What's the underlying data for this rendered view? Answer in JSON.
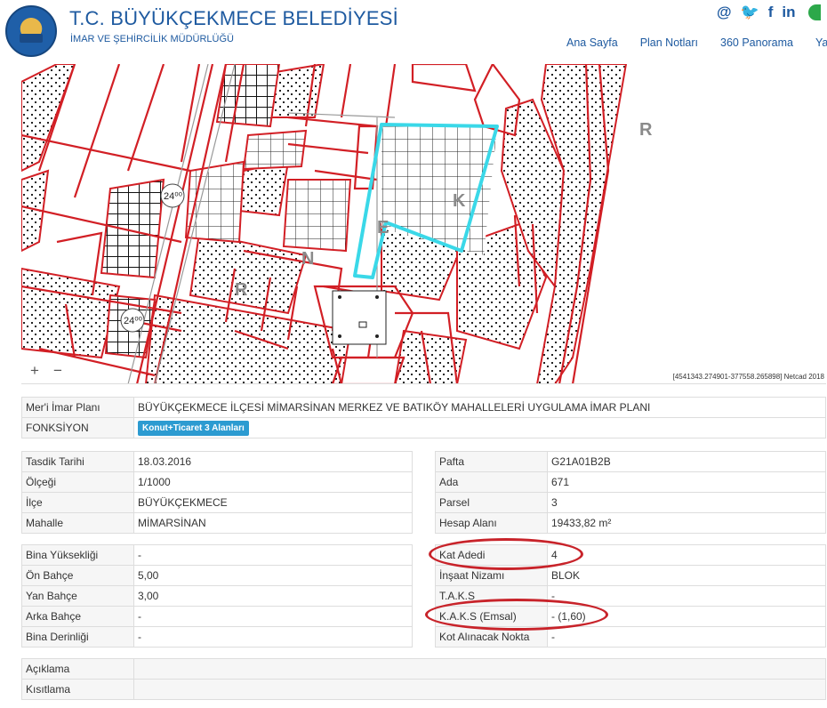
{
  "header": {
    "title": "T.C. BÜYÜKÇEKMECE BELEDİYESİ",
    "subtitle": "İMAR VE ŞEHİRCİLİK MÜDÜRLÜĞÜ",
    "social": [
      "@",
      "🐦",
      "f",
      "in"
    ],
    "nav": [
      "Ana Sayfa",
      "Plan Notları",
      "360 Panorama",
      "Yazd"
    ]
  },
  "map": {
    "zoom_in": "+",
    "zoom_out": "−",
    "coords": "[4541343.274901-377558.265898] Netcad 2018",
    "letters": [
      "R",
      "R",
      "N",
      "E",
      "K"
    ],
    "highlight_color": "#3ad8e8",
    "parcel_color": "#d21f25"
  },
  "plan": {
    "rows": [
      {
        "label": "Mer'i İmar Planı",
        "value": "BÜYÜKÇEKMECE İLÇESİ MİMARSİNAN MERKEZ VE BATIKÖY MAHALLELERİ UYGULAMA İMAR PLANI"
      },
      {
        "label": "FONKSİYON",
        "value": "Konut+Ticaret 3 Alanları"
      }
    ]
  },
  "left1": [
    {
      "label": "Tasdik Tarihi",
      "value": "18.03.2016"
    },
    {
      "label": "Ölçeği",
      "value": "1/1000"
    },
    {
      "label": "İlçe",
      "value": "BÜYÜKÇEKMECE"
    },
    {
      "label": "Mahalle",
      "value": "MİMARSİNAN"
    }
  ],
  "right1": [
    {
      "label": "Pafta",
      "value": "G21A01B2B"
    },
    {
      "label": "Ada",
      "value": "671"
    },
    {
      "label": "Parsel",
      "value": "3"
    },
    {
      "label": "Hesap Alanı",
      "value": "19433,82 m²"
    }
  ],
  "left2": [
    {
      "label": "Bina Yüksekliği",
      "value": "-"
    },
    {
      "label": "Ön Bahçe",
      "value": "5,00"
    },
    {
      "label": "Yan Bahçe",
      "value": "3,00"
    },
    {
      "label": "Arka Bahçe",
      "value": "-"
    },
    {
      "label": "Bina Derinliği",
      "value": "-"
    }
  ],
  "right2": [
    {
      "label": "Kat Adedi",
      "value": "4"
    },
    {
      "label": "İnşaat Nizamı",
      "value": "BLOK"
    },
    {
      "label": "T.A.K.S",
      "value": "-"
    },
    {
      "label": "K.A.K.S (Emsal)",
      "value": "- (1,60)"
    },
    {
      "label": "Kot Alınacak Nokta",
      "value": "-"
    }
  ],
  "notes": [
    {
      "label": "Açıklama",
      "value": ""
    },
    {
      "label": "Kısıtlama",
      "value": ""
    }
  ]
}
